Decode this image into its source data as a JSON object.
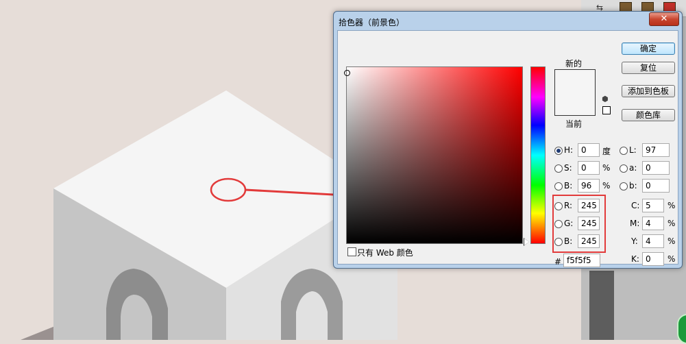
{
  "dialog": {
    "title": "拾色器（前景色）",
    "close_label": "✕",
    "new_label": "新的",
    "current_label": "当前",
    "buttons": {
      "ok": "确定",
      "reset": "复位",
      "add_to_swatches": "添加到色板",
      "color_libraries": "颜色库"
    },
    "hsb": {
      "h_label": "H:",
      "h_value": "0",
      "h_unit": "度",
      "s_label": "S:",
      "s_value": "0",
      "s_unit": "%",
      "b_label": "B:",
      "b_value": "96",
      "b_unit": "%"
    },
    "lab": {
      "l_label": "L:",
      "l_value": "97",
      "a_label": "a:",
      "a_value": "0",
      "b_label": "b:",
      "b_value": "0"
    },
    "rgb": {
      "r_label": "R:",
      "r_value": "245",
      "g_label": "G:",
      "g_value": "245",
      "b_label": "B:",
      "b_value": "245"
    },
    "cmyk": {
      "c_label": "C:",
      "c_value": "5",
      "c_unit": "%",
      "m_label": "M:",
      "m_value": "4",
      "m_unit": "%",
      "y_label": "Y:",
      "y_value": "4",
      "y_unit": "%",
      "k_label": "K:",
      "k_value": "0",
      "k_unit": "%"
    },
    "hex": {
      "label": "#",
      "value": "f5f5f5"
    },
    "web_only_label": "只有 Web 颜色",
    "new_color": "#f5f5f5",
    "current_color": "#f5f5f5"
  }
}
